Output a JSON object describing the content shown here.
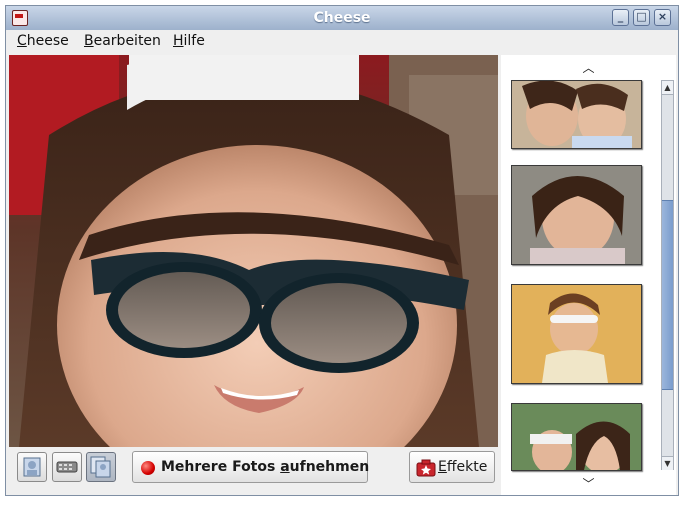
{
  "window": {
    "title": "Cheese"
  },
  "menubar": {
    "items": [
      {
        "mnemonic": "C",
        "rest": "heese"
      },
      {
        "mnemonic": "B",
        "rest": "earbeiten"
      },
      {
        "mnemonic": "H",
        "rest": "ilfe"
      }
    ]
  },
  "toolbar": {
    "capture_label_bold_pre": "Mehrere Fotos ",
    "capture_label_mnemonic": "a",
    "capture_label_post": "ufnehmen",
    "effects_mnemonic": "E",
    "effects_rest": "ffekte"
  },
  "icons": {
    "app": "cheese-app-icon",
    "minimize": "minimize-icon",
    "maximize": "maximize-icon",
    "close": "close-icon",
    "photo_mode": "photo-mode-icon",
    "video_mode": "video-mode-icon",
    "burst_mode": "burst-mode-icon",
    "record": "record-dot-icon",
    "effects": "effects-camera-icon",
    "scroll_up": "chevron-up-icon",
    "scroll_down": "chevron-down-icon"
  },
  "colors": {
    "titlebar": "#9db1cc",
    "record": "#d40000",
    "scroll_thumb": "#7a9ccc"
  }
}
